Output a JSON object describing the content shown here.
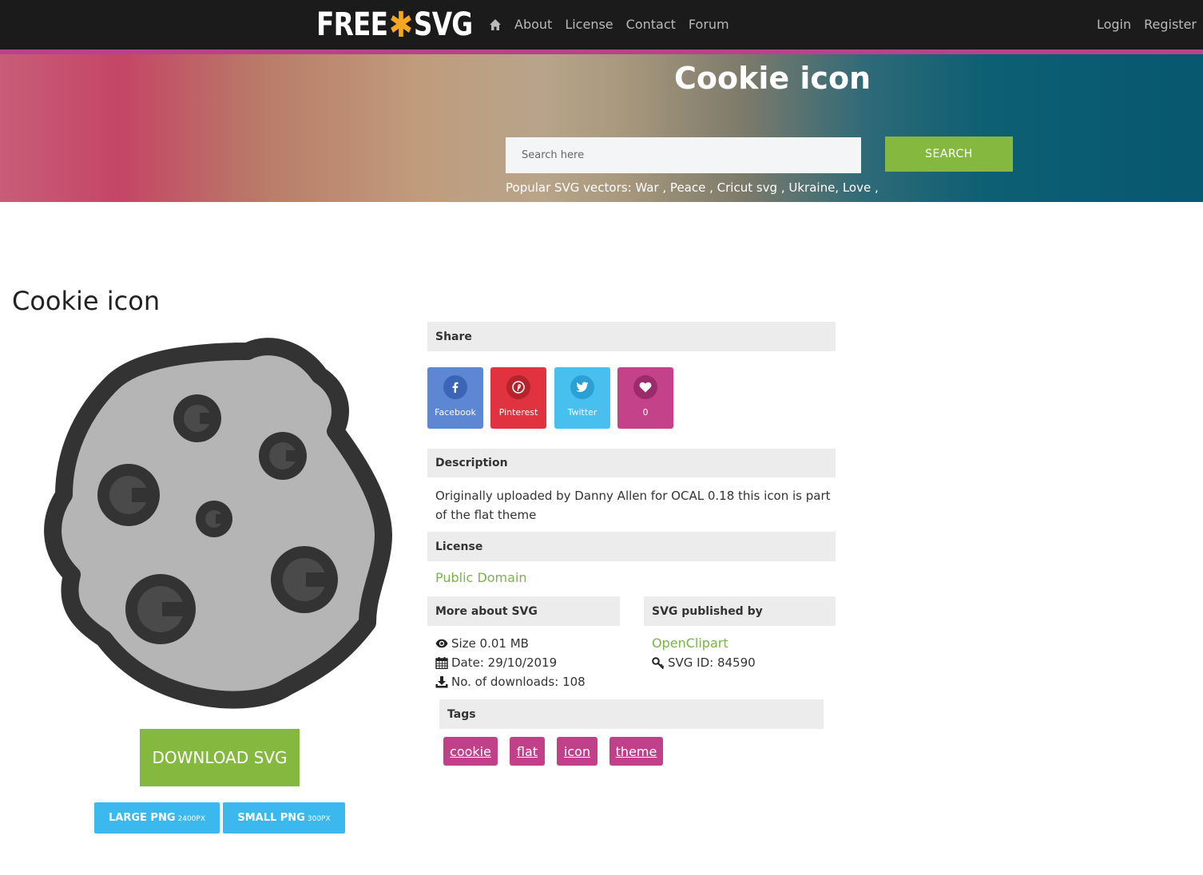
{
  "navbar": {
    "logo_left": "FREE",
    "logo_star": "✱",
    "logo_right": "SVG",
    "links": [
      "About",
      "License",
      "Contact",
      "Forum"
    ],
    "login": "Login",
    "register": "Register"
  },
  "hero": {
    "title": "Cookie icon",
    "search_placeholder": "Search here",
    "search_button": "SEARCH",
    "popular_text": "Popular SVG vectors: War , Peace , Cricut svg , Ukraine, Love ,"
  },
  "main": {
    "title": "Cookie icon",
    "download_svg": "DOWNLOAD SVG",
    "large_png": "LARGE PNG",
    "large_png_size": "2400PX",
    "small_png": "SMALL PNG",
    "small_png_size": "300PX"
  },
  "share": {
    "heading": "Share",
    "facebook": "Facebook",
    "pinterest": "Pinterest",
    "twitter": "Twitter",
    "likes": "0"
  },
  "description": {
    "heading": "Description",
    "text": "Originally uploaded by Danny Allen for OCAL 0.18 this icon is part of the flat theme"
  },
  "license": {
    "heading": "License",
    "value": "Public Domain"
  },
  "more_about": {
    "heading": "More about SVG",
    "size": "Size 0.01 MB",
    "date": "Date: 29/10/2019",
    "downloads": "No. of downloads: 108"
  },
  "published_by": {
    "heading": "SVG published by",
    "publisher": "OpenClipart",
    "svg_id": "SVG ID: 84590"
  },
  "tags": {
    "heading": "Tags",
    "items": [
      "cookie",
      "flat",
      "icon",
      "theme"
    ]
  },
  "colors": {
    "accent_green": "#85b83f",
    "tag_magenta": "#c0418a",
    "png_blue": "#3bb9ee"
  }
}
